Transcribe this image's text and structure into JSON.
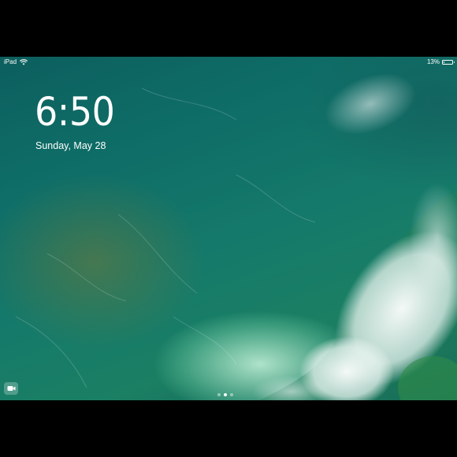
{
  "status_bar": {
    "device_label": "iPad",
    "wifi_icon": "wifi-icon",
    "battery_text": "13%",
    "battery_level": 0.13,
    "battery_icon": "battery-icon"
  },
  "lock_screen": {
    "time": "6:50",
    "date": "Sunday, May 28"
  },
  "bottom": {
    "camera_icon": "camera-icon",
    "page_dots": {
      "count": 3,
      "active_index": 1
    }
  },
  "colors": {
    "text": "#ffffff",
    "frame": "#000000",
    "ocean": "#0f6f68"
  }
}
